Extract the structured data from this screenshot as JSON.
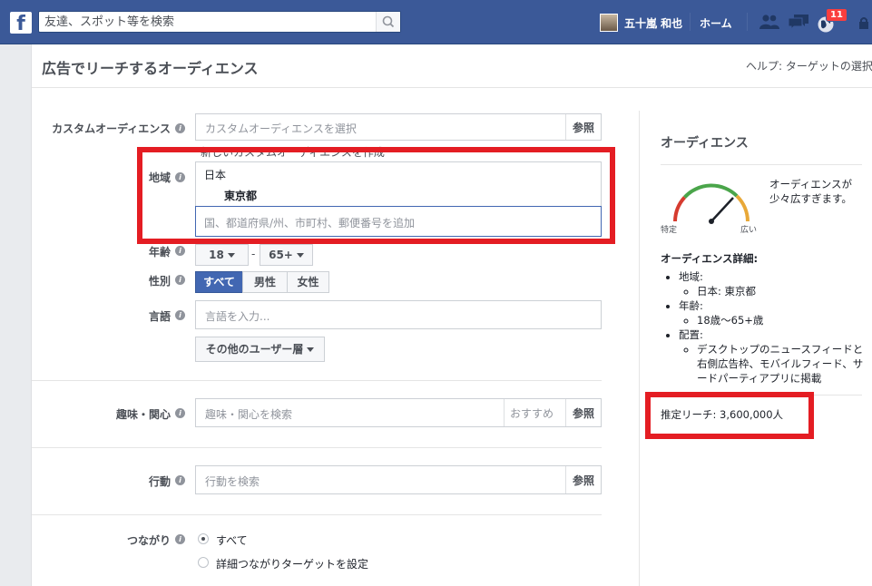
{
  "topbar": {
    "search_placeholder": "友達、スポット等を検索",
    "user_name": "五十嵐 和也",
    "home_label": "ホーム",
    "notification_count": "11"
  },
  "page": {
    "title": "広告でリーチするオーディエンス",
    "help_link": "ヘルプ: ターゲットの選択"
  },
  "form": {
    "custom_audience": {
      "label": "カスタムオーディエンス",
      "placeholder": "カスタムオーディエンスを選択",
      "browse": "参照",
      "sub_hint": "新しいカスタムオーディエンスを作成"
    },
    "location": {
      "label": "地域",
      "country": "日本",
      "region": "東京都",
      "placeholder": "国、都道府県/州、市町村、郵便番号を追加"
    },
    "age": {
      "label": "年齢",
      "min": "18",
      "max": "65+",
      "dash": "-"
    },
    "gender": {
      "label": "性別",
      "options": [
        "すべて",
        "男性",
        "女性"
      ]
    },
    "language": {
      "label": "言語",
      "placeholder": "言語を入力..."
    },
    "more_demographics": "その他のユーザー層",
    "interests": {
      "label": "趣味・関心",
      "placeholder": "趣味・関心を検索",
      "suggest": "おすすめ",
      "browse": "参照"
    },
    "behaviors": {
      "label": "行動",
      "placeholder": "行動を検索",
      "browse": "参照"
    },
    "connections": {
      "label": "つながり",
      "options": [
        "すべて",
        "詳細つながりターゲットを設定"
      ]
    }
  },
  "sidebar": {
    "title": "オーディエンス",
    "gauge_message": "オーディエンスが少々広すぎます。",
    "gauge_left": "特定",
    "gauge_right": "広い",
    "details_title": "オーディエンス詳細:",
    "details": [
      {
        "label": "地域:",
        "value": "日本: 東京都"
      },
      {
        "label": "年齢:",
        "value": "18歳〜65+歳"
      },
      {
        "label": "配置:",
        "value": "デスクトップのニュースフィードと右側広告枠、モバイルフィード、サードパーティアプリに掲載"
      }
    ],
    "reach": "推定リーチ: 3,600,000人"
  },
  "colors": {
    "brand": "#3b5998",
    "highlight": "#e41d23",
    "button_selected": "#4267b2"
  }
}
